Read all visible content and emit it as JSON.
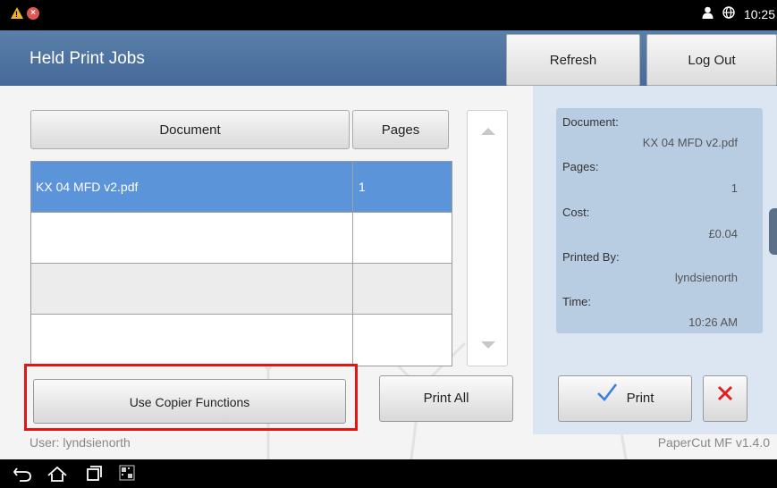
{
  "status_bar": {
    "time": "10:25"
  },
  "header": {
    "title": "Held Print Jobs",
    "refresh_label": "Refresh",
    "logout_label": "Log Out"
  },
  "job_table": {
    "columns": [
      "Document",
      "Pages"
    ],
    "rows": [
      {
        "document": "KX 04 MFD v2.pdf",
        "pages": "1",
        "selected": true
      },
      {
        "document": "",
        "pages": ""
      },
      {
        "document": "",
        "pages": ""
      },
      {
        "document": "",
        "pages": ""
      }
    ]
  },
  "details": {
    "document_label": "Document:",
    "document_value": "KX 04 MFD v2.pdf",
    "pages_label": "Pages:",
    "pages_value": "1",
    "cost_label": "Cost:",
    "cost_value": "£0.04",
    "printed_by_label": "Printed By:",
    "printed_by_value": "lyndsienorth",
    "time_label": "Time:",
    "time_value": "10:26 AM"
  },
  "actions": {
    "copier_label": "Use Copier Functions",
    "print_all_label": "Print All",
    "print_label": "Print"
  },
  "footer": {
    "user": "User: lyndsienorth",
    "version": "PaperCut MF v1.4.0"
  },
  "colors": {
    "title_bar": "#4e73a0",
    "selected_row": "#5b94d9",
    "details_panel": "#b8cce2",
    "highlight_box": "#e11111",
    "checkmark": "#3a7fe0",
    "cancel_x": "#e02020"
  },
  "icons": [
    "warning-icon",
    "error-icon",
    "person-icon",
    "globe-icon",
    "back-icon",
    "home-icon",
    "recent-apps-icon",
    "screenshot-icon",
    "checkmark-icon",
    "cancel-x-icon",
    "scroll-up-icon",
    "scroll-down-icon"
  ]
}
